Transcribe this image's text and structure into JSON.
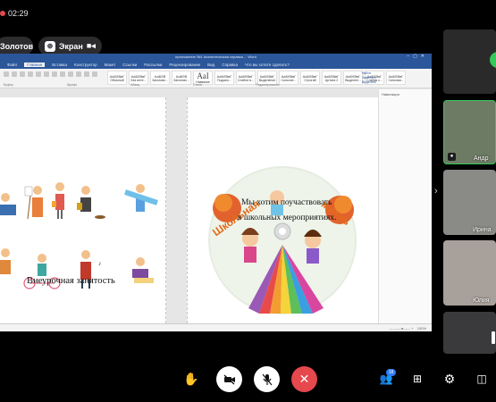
{
  "timer": {
    "time": "02:29",
    "dot_color": "#e24b4b"
  },
  "top_bar": {
    "user_pill": "Золотов",
    "screen_pill": "Экран"
  },
  "word": {
    "title": "приложение №1 Аналитическая справка ... Word",
    "tabs": [
      "Файл",
      "Главная",
      "Вставка",
      "Конструктор",
      "Макет",
      "Ссылки",
      "Рассылки",
      "Рецензирование",
      "Вид",
      "Справка",
      "Что вы хотите сделать?"
    ],
    "styles": [
      {
        "sample": "АаБбВвГ",
        "name": "Обычный"
      },
      {
        "sample": "АаБбВвГ",
        "name": "Без инте..."
      },
      {
        "sample": "АаБбВ",
        "name": "Заголово..."
      },
      {
        "sample": "АаБбВ",
        "name": "Заголово..."
      },
      {
        "sample": "АаІ",
        "name": "Название"
      },
      {
        "sample": "АаБбВвГ",
        "name": "Подзаго..."
      },
      {
        "sample": "АаБбВвГ",
        "name": "Слабое в..."
      },
      {
        "sample": "АаБбВвГ",
        "name": "Выделение"
      },
      {
        "sample": "АаБбВвГ",
        "name": "Сильное..."
      },
      {
        "sample": "АаБбВвГ",
        "name": "Строгий"
      },
      {
        "sample": "АаБбВвГ",
        "name": "Цитата 2"
      },
      {
        "sample": "АаБбВвГ",
        "name": "Выделен..."
      },
      {
        "sample": "АаБбВвГ",
        "name": "Слабая с..."
      },
      {
        "sample": "АаБбВвГ",
        "name": "Сильная..."
      }
    ],
    "ribbon_right": [
      "Найти",
      "Заменить",
      "Выделить"
    ],
    "ribbon_groups": [
      "Буфер",
      "Шрифт",
      "Абзац",
      "Стили",
      "Редактирование"
    ],
    "pane_title": "Навигация",
    "left_page_text": "Внеурочная занятость",
    "right_page_line1": "Мы хотим поучаствовать",
    "right_page_line2": "в школьных мероприятиях.",
    "disc_title_1": "Школьная",
    "disc_title_2": "жизнь",
    "zoom": "100%"
  },
  "participants": [
    {
      "name": ""
    },
    {
      "name": "Андр"
    },
    {
      "name": "Ирина"
    },
    {
      "name": "Юлия"
    },
    {
      "name": ""
    }
  ],
  "controls": {
    "participants_count": "18"
  }
}
